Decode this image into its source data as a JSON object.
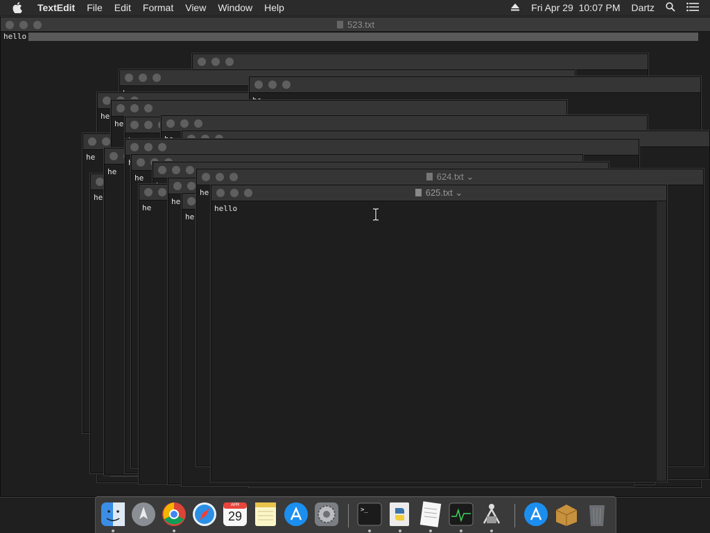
{
  "menubar": {
    "app_name": "TextEdit",
    "menus": [
      "File",
      "Edit",
      "Format",
      "View",
      "Window",
      "Help"
    ],
    "datetime": "Fri Apr 29  10:07 PM",
    "user": "Dartz"
  },
  "windows": {
    "back": {
      "title": "523.txt",
      "content": "hello"
    },
    "w624": {
      "title": "624.txt"
    },
    "front": {
      "title": "625.txt",
      "content": "hello"
    },
    "stack_fragments": [
      "he",
      "he",
      "he",
      "he",
      "he",
      "he",
      "he",
      "he",
      "he",
      "he",
      "he",
      "he"
    ]
  },
  "dock": {
    "items": [
      "Finder",
      "Launchpad",
      "Chrome",
      "Safari",
      "Calendar",
      "Notes",
      "App Store",
      "System Preferences",
      "Terminal",
      "Python Launcher",
      "TextEdit",
      "Activity Monitor",
      "Directory Utility",
      "App Store",
      "Installer",
      "Trash"
    ],
    "calendar_day": "29",
    "calendar_month": "APR"
  }
}
